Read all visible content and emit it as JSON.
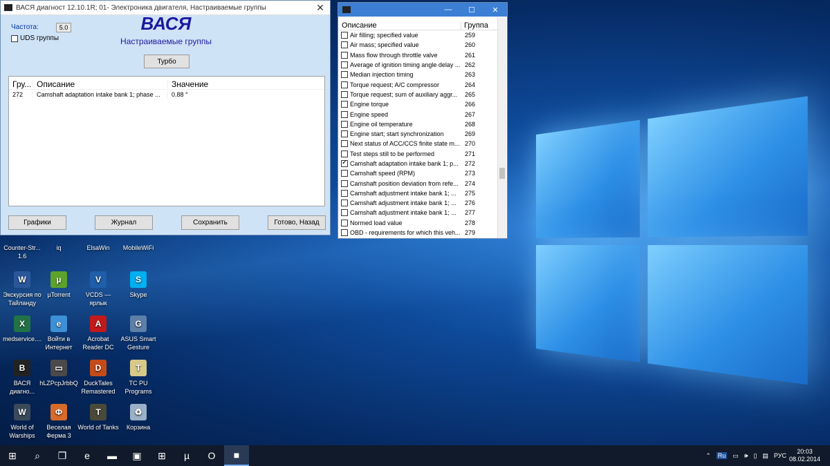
{
  "window_main": {
    "title": "ВАСЯ диагност 12.10.1R; 01- Электроника двигателя,  Настраиваемые группы",
    "close": "✕",
    "brand": "ВАСЯ",
    "subtitle": "Настраиваемые группы",
    "freq_label": "Частота:",
    "freq_value": "5.0",
    "uds_label": "UDS группы",
    "turbo_button": "Турбо",
    "table": {
      "headers": [
        "Гру...",
        "Описание",
        "Значение"
      ],
      "rows": [
        {
          "group": "272",
          "desc": "Camshaft adaptation intake bank 1; phase ...",
          "value": "0.88 °"
        }
      ]
    },
    "buttons": {
      "graphs": "Графики",
      "journal": "Журнал",
      "save": "Сохранить",
      "done": "Готово, Назад"
    }
  },
  "window_groups": {
    "header_desc": "Описание",
    "header_group": "Группа",
    "items": [
      {
        "desc": "Air filling; specified value",
        "group": "259",
        "checked": false
      },
      {
        "desc": "Air mass; specified value",
        "group": "260",
        "checked": false
      },
      {
        "desc": "Mass flow through throttle valve",
        "group": "261",
        "checked": false
      },
      {
        "desc": "Average of ignition timing angle delay ...",
        "group": "262",
        "checked": false
      },
      {
        "desc": "Median injection timing",
        "group": "263",
        "checked": false
      },
      {
        "desc": "Torque request; A/C compressor",
        "group": "264",
        "checked": false
      },
      {
        "desc": "Torque request; sum of auxiliary aggr...",
        "group": "265",
        "checked": false
      },
      {
        "desc": "Engine torque",
        "group": "266",
        "checked": false
      },
      {
        "desc": "Engine speed",
        "group": "267",
        "checked": false
      },
      {
        "desc": "Engine oil temperature",
        "group": "268",
        "checked": false
      },
      {
        "desc": "Engine start; start synchronization",
        "group": "269",
        "checked": false
      },
      {
        "desc": "Next status of ACC/CCS finite state m...",
        "group": "270",
        "checked": false
      },
      {
        "desc": "Test steps still to be performed",
        "group": "271",
        "checked": false
      },
      {
        "desc": "Camshaft adaptation intake bank 1; p...",
        "group": "272",
        "checked": true
      },
      {
        "desc": "Camshaft speed (RPM)",
        "group": "273",
        "checked": false
      },
      {
        "desc": "Camshaft position deviation from refe...",
        "group": "274",
        "checked": false
      },
      {
        "desc": "Camshaft adjustment intake bank 1; ...",
        "group": "275",
        "checked": false
      },
      {
        "desc": "Camshaft adjustment intake bank 1; ...",
        "group": "276",
        "checked": false
      },
      {
        "desc": "Camshaft adjustment intake bank 1; ...",
        "group": "277",
        "checked": false
      },
      {
        "desc": "Normed load value",
        "group": "278",
        "checked": false
      },
      {
        "desc": "OBD - requirements for which this veh...",
        "group": "279",
        "checked": false
      }
    ]
  },
  "desktop_icons": [
    {
      "label": "Counter-Str... 1.6",
      "icon": "cs-icon",
      "color": "#5a4a2a",
      "glyph": "CS"
    },
    {
      "label": "iq",
      "icon": "iq-icon",
      "color": "#3a6fb0",
      "glyph": "iq"
    },
    {
      "label": "ElsaWin",
      "icon": "elsawin-icon",
      "color": "#2b5fa5",
      "glyph": "E"
    },
    {
      "label": "MobileWiFi",
      "icon": "wifi-icon",
      "color": "#3c80c0",
      "glyph": "W"
    },
    {
      "label": "Экскурсия по Тайланду",
      "icon": "word-doc-icon",
      "color": "#2b579a",
      "glyph": "W"
    },
    {
      "label": "µTorrent",
      "icon": "utorrent-icon",
      "color": "#5da22b",
      "glyph": "µ"
    },
    {
      "label": "VCDS — ярлык",
      "icon": "vcds-icon",
      "color": "#1f5ea8",
      "glyph": "V"
    },
    {
      "label": "Skype",
      "icon": "skype-icon",
      "color": "#00aff0",
      "glyph": "S"
    },
    {
      "label": "medservice....",
      "icon": "excel-doc-icon",
      "color": "#217346",
      "glyph": "X"
    },
    {
      "label": "Войти в Интернет",
      "icon": "internet-icon",
      "color": "#3d8fd6",
      "glyph": "e"
    },
    {
      "label": "Acrobat Reader DC",
      "icon": "acrobat-icon",
      "color": "#c21a1a",
      "glyph": "A"
    },
    {
      "label": "ASUS Smart Gesture",
      "icon": "asus-gesture-icon",
      "color": "#5d7fa8",
      "glyph": "G"
    },
    {
      "label": "ВАСЯ диагно...",
      "icon": "vasya-icon",
      "color": "#222222",
      "glyph": "В"
    },
    {
      "label": "hLZPcpJrbbQ",
      "icon": "image-file-icon",
      "color": "#4a4a4a",
      "glyph": "▭"
    },
    {
      "label": "DuckTales Remastered",
      "icon": "ducktales-icon",
      "color": "#c44b1a",
      "glyph": "D"
    },
    {
      "label": "TC PU Programs",
      "icon": "tc-icon",
      "color": "#d8c98a",
      "glyph": "T"
    },
    {
      "label": "World of Warships",
      "icon": "wows-icon",
      "color": "#3a4a5a",
      "glyph": "W"
    },
    {
      "label": "Веселая Ферма 3",
      "icon": "farm-icon",
      "color": "#d86a2a",
      "glyph": "Ф"
    },
    {
      "label": "World of Tanks",
      "icon": "wot-icon",
      "color": "#4a4a3a",
      "glyph": "T"
    },
    {
      "label": "Корзина",
      "icon": "recycle-bin-icon",
      "color": "#9ab0c8",
      "glyph": "♻"
    }
  ],
  "taskbar": {
    "items": [
      {
        "icon": "start-icon",
        "glyph": "⊞"
      },
      {
        "icon": "search-icon",
        "glyph": "⌕"
      },
      {
        "icon": "task-view-icon",
        "glyph": "❐"
      },
      {
        "icon": "edge-icon",
        "glyph": "e"
      },
      {
        "icon": "explorer-icon",
        "glyph": "▬"
      },
      {
        "icon": "app-icon",
        "glyph": "▣"
      },
      {
        "icon": "store-icon",
        "glyph": "⊞"
      },
      {
        "icon": "utorrent-taskbar-icon",
        "glyph": "µ"
      },
      {
        "icon": "opera-icon",
        "glyph": "O"
      },
      {
        "icon": "vasya-taskbar-icon",
        "glyph": "■"
      }
    ],
    "tray": {
      "ru_badge": "Ru",
      "lang": "РУС",
      "time": "20:03",
      "date": "08.02.2014"
    }
  }
}
